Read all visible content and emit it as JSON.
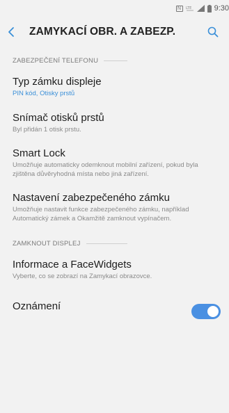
{
  "status_bar": {
    "time": "9:30",
    "nfc_label": "N"
  },
  "header": {
    "title": "ZAMYKACÍ OBR. A ZABEZP."
  },
  "sections": [
    {
      "title": "ZABEZPEČENÍ TELEFONU",
      "items": [
        {
          "title": "Typ zámku displeje",
          "subtitle": "PIN kód, Otisky prstů"
        },
        {
          "title": "Snímač otisků prstů",
          "subtitle": "Byl přidán 1 otisk prstu."
        },
        {
          "title": "Smart Lock",
          "subtitle": "Umožňuje automaticky odemknout mobilní zařízení, pokud byla zjištěna důvěryhodná místa nebo jiná zařízení."
        },
        {
          "title": "Nastavení zabezpečeného zámku",
          "subtitle": "Umožňuje nastavit funkce zabezpečeného zámku, například Automatický zámek a Okamžitě zamknout vypínačem."
        }
      ]
    },
    {
      "title": "ZAMKNOUT DISPLEJ",
      "items": [
        {
          "title": "Informace a FaceWidgets",
          "subtitle": "Vyberte, co se zobrazí na Zamykací obrazovce."
        },
        {
          "title": "Oznámení",
          "toggle_on": true
        }
      ]
    }
  ],
  "colors": {
    "accent": "#3a8fd8",
    "toggle": "#4a90e2",
    "background": "#f2f2f2"
  },
  "icons": {
    "back": "chevron-left-icon",
    "search": "search-icon"
  }
}
